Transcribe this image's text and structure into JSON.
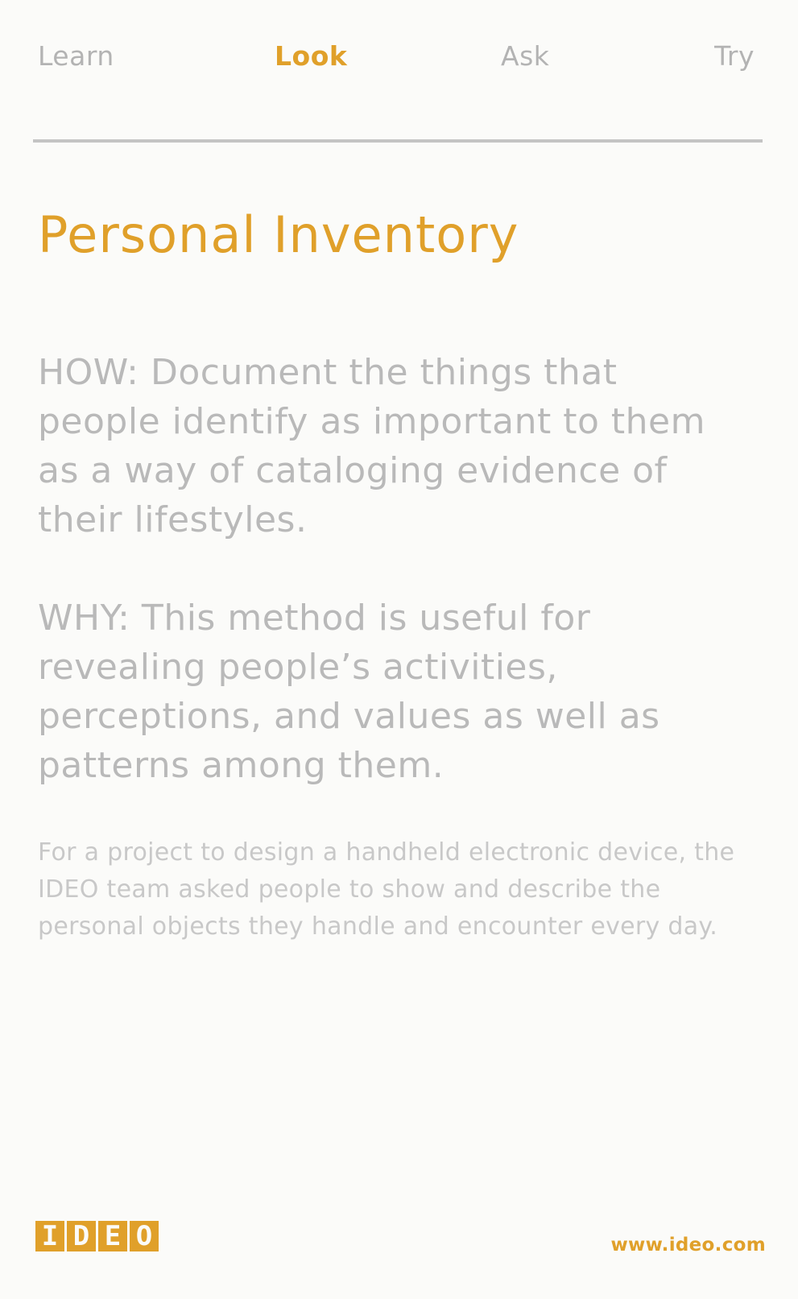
{
  "nav": {
    "items": [
      {
        "label": "Learn",
        "active": false
      },
      {
        "label": "Look",
        "active": true
      },
      {
        "label": "Ask",
        "active": false
      },
      {
        "label": "Try",
        "active": false
      }
    ]
  },
  "card": {
    "title": "Personal Inventory",
    "how": "HOW: Document the things that people identify as important to them as a way of cataloging evidence of their lifestyles.",
    "why": "WHY: This method is useful for revealing people’s activities, perceptions, and values as well as patterns among them.",
    "example": "For a project to design a handheld electronic device, the IDEO team asked people to show and describe the personal objects they handle and encounter every day."
  },
  "footer": {
    "logo_letters": [
      "I",
      "D",
      "E",
      "O"
    ],
    "url": "www.ideo.com"
  },
  "colors": {
    "accent": "#e0a02a",
    "text_gray": "#b9b9b9",
    "light_gray": "#c8c8c8",
    "background": "#fbfbf9"
  }
}
